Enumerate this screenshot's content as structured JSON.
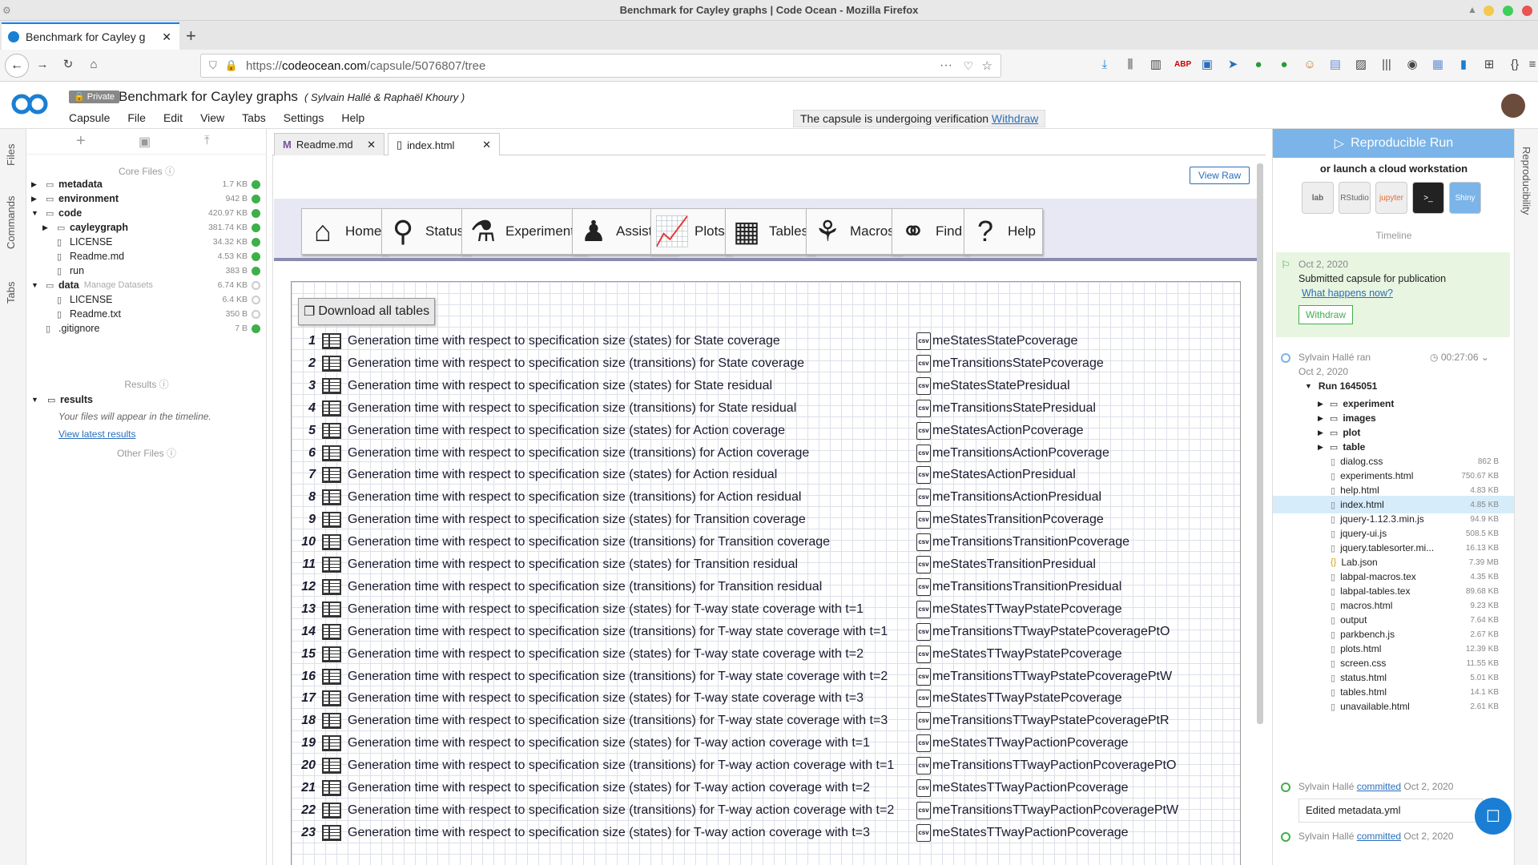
{
  "window": {
    "title": "Benchmark for Cayley graphs | Code Ocean - Mozilla Firefox"
  },
  "browser": {
    "tab_title": "Benchmark for Cayley g",
    "new_tab": "+",
    "url_prefix": "https://",
    "url_host": "codeocean.com",
    "url_path": "/capsule/5076807/tree"
  },
  "app": {
    "badge": "Private",
    "capsule_title": "Benchmark for Cayley graphs",
    "authors": "( Sylvain Hallé & Raphaël Khoury )",
    "menu": [
      "Capsule",
      "File",
      "Edit",
      "View",
      "Tabs",
      "Settings",
      "Help"
    ],
    "verification_text": "The capsule is undergoing verification",
    "verification_link": "Withdraw"
  },
  "left_rail": {
    "tabs": [
      "Files",
      "Commands",
      "Tabs"
    ]
  },
  "file_panel": {
    "core_files_label": "Core Files",
    "results_label": "Results",
    "other_files_label": "Other Files",
    "results_folder": "results",
    "results_hint": "Your files will appear in the timeline.",
    "results_link": "View latest results",
    "manage_datasets": "Manage Datasets",
    "items": [
      {
        "name": "metadata",
        "size": "1.7 KB",
        "bold": true,
        "indent": 0,
        "arrow": true
      },
      {
        "name": "environment",
        "size": "942 B",
        "bold": true,
        "indent": 0,
        "arrow": true
      },
      {
        "name": "code",
        "size": "420.97 KB",
        "bold": true,
        "indent": 0,
        "arrow": true,
        "open": true
      },
      {
        "name": "cayleygraph",
        "size": "381.74 KB",
        "bold": true,
        "indent": 1,
        "arrow": true
      },
      {
        "name": "LICENSE",
        "size": "34.32 KB",
        "bold": false,
        "indent": 1
      },
      {
        "name": "Readme.md",
        "size": "4.53 KB",
        "bold": false,
        "indent": 1
      },
      {
        "name": "run",
        "size": "383 B",
        "bold": false,
        "indent": 1
      },
      {
        "name": "data",
        "size": "6.74 KB",
        "bold": true,
        "indent": 0,
        "arrow": true,
        "open": true
      },
      {
        "name": "LICENSE",
        "size": "6.4 KB",
        "bold": false,
        "indent": 1
      },
      {
        "name": "Readme.txt",
        "size": "350 B",
        "bold": false,
        "indent": 1
      },
      {
        "name": ".gitignore",
        "size": "7 B",
        "bold": false,
        "indent": 0
      }
    ]
  },
  "editor_tabs": [
    "Readme.md",
    "index.html"
  ],
  "viewer": {
    "view_raw": "View Raw",
    "nav": [
      {
        "label": "Home",
        "icon": "home-icon",
        "glyph": "⌂"
      },
      {
        "label": "Status",
        "icon": "status-icon",
        "glyph": "⚲"
      },
      {
        "label": "Experiments",
        "icon": "flask-icon",
        "glyph": "⚗"
      },
      {
        "label": "Assistant",
        "icon": "person-icon",
        "glyph": "♟"
      },
      {
        "label": "Plots",
        "icon": "plot-icon",
        "glyph": "📈"
      },
      {
        "label": "Tables",
        "icon": "table-icon",
        "glyph": "▦"
      },
      {
        "label": "Macros",
        "icon": "tulip-icon",
        "glyph": "⚘"
      },
      {
        "label": "Find",
        "icon": "binoculars-icon",
        "glyph": "⚭"
      },
      {
        "label": "Help",
        "icon": "help-icon",
        "glyph": "?"
      }
    ],
    "download_all": "Download all tables",
    "tables": [
      {
        "num": "1",
        "title": "Generation time with respect to specification size (states) for State coverage",
        "csv": "meStatesStatePcoverage"
      },
      {
        "num": "2",
        "title": "Generation time with respect to specification size (transitions) for State coverage",
        "csv": "meTransitionsStatePcoverage"
      },
      {
        "num": "3",
        "title": "Generation time with respect to specification size (states) for State residual",
        "csv": "meStatesStatePresidual"
      },
      {
        "num": "4",
        "title": "Generation time with respect to specification size (transitions) for State residual",
        "csv": "meTransitionsStatePresidual"
      },
      {
        "num": "5",
        "title": "Generation time with respect to specification size (states) for Action coverage",
        "csv": "meStatesActionPcoverage"
      },
      {
        "num": "6",
        "title": "Generation time with respect to specification size (transitions) for Action coverage",
        "csv": "meTransitionsActionPcoverage"
      },
      {
        "num": "7",
        "title": "Generation time with respect to specification size (states) for Action residual",
        "csv": "meStatesActionPresidual"
      },
      {
        "num": "8",
        "title": "Generation time with respect to specification size (transitions) for Action residual",
        "csv": "meTransitionsActionPresidual"
      },
      {
        "num": "9",
        "title": "Generation time with respect to specification size (states) for Transition coverage",
        "csv": "meStatesTransitionPcoverage"
      },
      {
        "num": "10",
        "title": "Generation time with respect to specification size (transitions) for Transition coverage",
        "csv": "meTransitionsTransitionPcoverage"
      },
      {
        "num": "11",
        "title": "Generation time with respect to specification size (states) for Transition residual",
        "csv": "meStatesTransitionPresidual"
      },
      {
        "num": "12",
        "title": "Generation time with respect to specification size (transitions) for Transition residual",
        "csv": "meTransitionsTransitionPresidual"
      },
      {
        "num": "13",
        "title": "Generation time with respect to specification size (states) for T-way state coverage with t=1",
        "csv": "meStatesTTwayPstatePcoverage"
      },
      {
        "num": "14",
        "title": "Generation time with respect to specification size (transitions) for T-way state coverage with t=1",
        "csv": "meTransitionsTTwayPstatePcoveragePtO"
      },
      {
        "num": "15",
        "title": "Generation time with respect to specification size (states) for T-way state coverage with t=2",
        "csv": "meStatesTTwayPstatePcoverage"
      },
      {
        "num": "16",
        "title": "Generation time with respect to specification size (transitions) for T-way state coverage with t=2",
        "csv": "meTransitionsTTwayPstatePcoveragePtW"
      },
      {
        "num": "17",
        "title": "Generation time with respect to specification size (states) for T-way state coverage with t=3",
        "csv": "meStatesTTwayPstatePcoverage"
      },
      {
        "num": "18",
        "title": "Generation time with respect to specification size (transitions) for T-way state coverage with t=3",
        "csv": "meTransitionsTTwayPstatePcoveragePtR"
      },
      {
        "num": "19",
        "title": "Generation time with respect to specification size (states) for T-way action coverage with t=1",
        "csv": "meStatesTTwayPactionPcoverage"
      },
      {
        "num": "20",
        "title": "Generation time with respect to specification size (transitions) for T-way action coverage with t=1",
        "csv": "meTransitionsTTwayPactionPcoveragePtO"
      },
      {
        "num": "21",
        "title": "Generation time with respect to specification size (states) for T-way action coverage with t=2",
        "csv": "meStatesTTwayPactionPcoverage"
      },
      {
        "num": "22",
        "title": "Generation time with respect to specification size (transitions) for T-way action coverage with t=2",
        "csv": "meTransitionsTTwayPactionPcoveragePtW"
      },
      {
        "num": "23",
        "title": "Generation time with respect to specification size (states) for T-way action coverage with t=3",
        "csv": "meStatesTTwayPactionPcoverage"
      }
    ]
  },
  "right_panel": {
    "reproducible_run": "Reproducible Run",
    "or_launch": "or launch a cloud workstation",
    "workstations": [
      "lab",
      "RStudio",
      "jupyter",
      ">_",
      "Shiny"
    ],
    "timeline_label": "Timeline",
    "submitted_date": "Oct 2, 2020",
    "submitted_text": "Submitted capsule for publication",
    "what_happens": "What happens now?",
    "withdraw": "Withdraw",
    "run_author": "Sylvain Hallé ran",
    "run_duration": "00:27:06",
    "run_date": "Oct 2, 2020",
    "run_name": "Run 1645051",
    "folders": [
      "experiment",
      "images",
      "plot",
      "table"
    ],
    "files": [
      {
        "name": "dialog.css",
        "size": "862 B"
      },
      {
        "name": "experiments.html",
        "size": "750.67 KB"
      },
      {
        "name": "help.html",
        "size": "4.83 KB"
      },
      {
        "name": "index.html",
        "size": "4.85 KB"
      },
      {
        "name": "jquery-1.12.3.min.js",
        "size": "94.9 KB"
      },
      {
        "name": "jquery-ui.js",
        "size": "508.5 KB"
      },
      {
        "name": "jquery.tablesorter.mi...",
        "size": "16.13 KB"
      },
      {
        "name": "Lab.json",
        "size": "7.39 MB"
      },
      {
        "name": "labpal-macros.tex",
        "size": "4.35 KB"
      },
      {
        "name": "labpal-tables.tex",
        "size": "89.68 KB"
      },
      {
        "name": "macros.html",
        "size": "9.23 KB"
      },
      {
        "name": "output",
        "size": "7.64 KB"
      },
      {
        "name": "parkbench.js",
        "size": "2.67 KB"
      },
      {
        "name": "plots.html",
        "size": "12.39 KB"
      },
      {
        "name": "screen.css",
        "size": "11.55 KB"
      },
      {
        "name": "status.html",
        "size": "5.01 KB"
      },
      {
        "name": "tables.html",
        "size": "14.1 KB"
      },
      {
        "name": "unavailable.html",
        "size": "2.61 KB"
      }
    ],
    "commit_author": "Sylvain Hallé",
    "commit_verb": "committed",
    "commit_date": "Oct 2, 2020",
    "commit_msg": "Edited metadata.yml",
    "commit2_author": "Sylvain Hallé",
    "commit2_verb": "committed",
    "commit2_date": "Oct 2, 2020"
  },
  "right_rail": {
    "label": "Reproducibility"
  }
}
